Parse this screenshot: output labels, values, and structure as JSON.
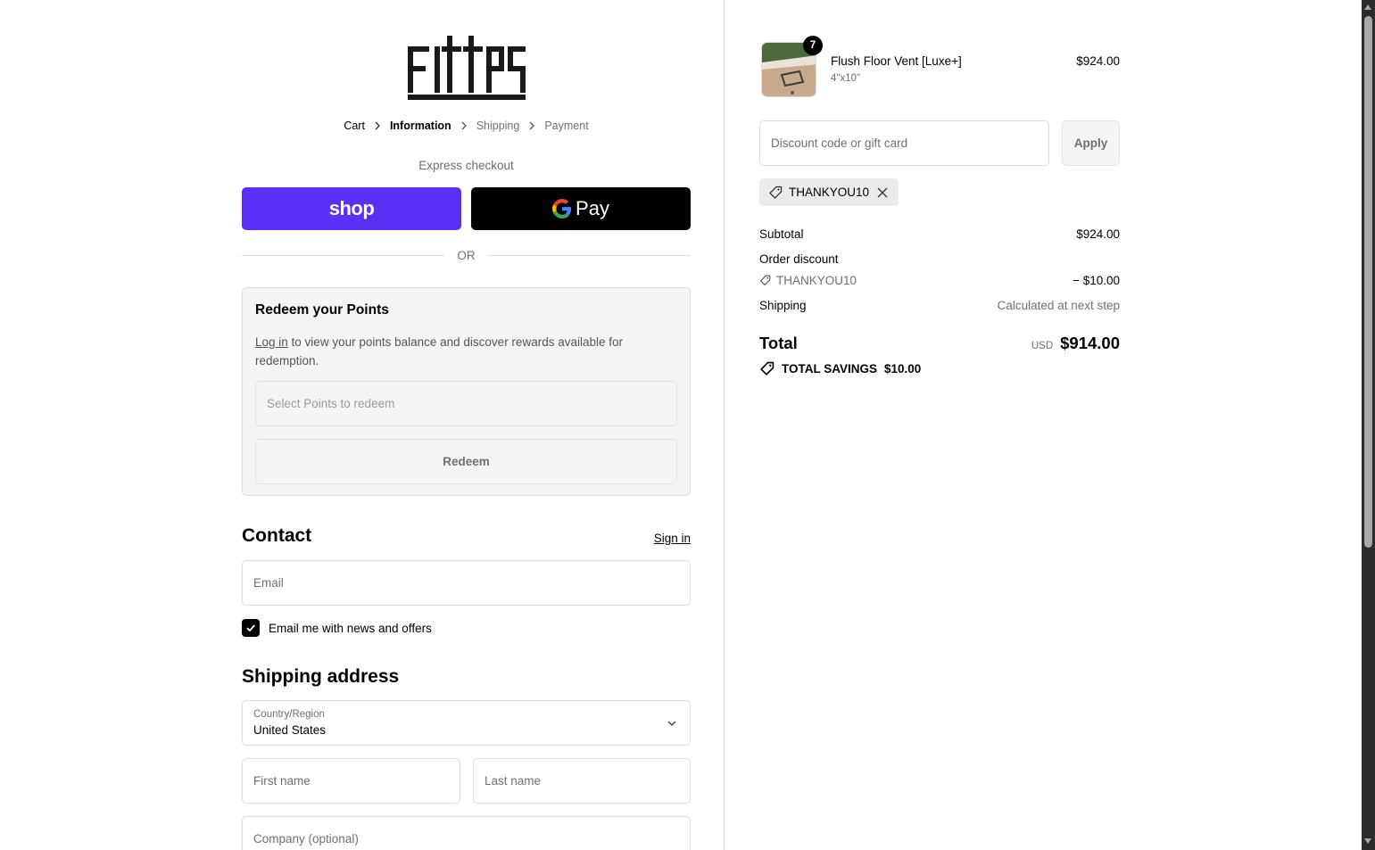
{
  "brand": {
    "logo_text": "Fittes"
  },
  "breadcrumb": [
    {
      "label": "Cart",
      "state": "done"
    },
    {
      "label": "Information",
      "state": "current"
    },
    {
      "label": "Shipping",
      "state": "upcoming"
    },
    {
      "label": "Payment",
      "state": "upcoming"
    }
  ],
  "express": {
    "label": "Express checkout",
    "shop_label": "shop",
    "gpay_label": "Pay",
    "or_text": "OR",
    "shop_color": "#5a31f4"
  },
  "points": {
    "title": "Redeem your Points",
    "login_link": "Log in",
    "text": " to view your points balance and discover rewards available for redemption.",
    "select_placeholder": "Select Points to redeem",
    "redeem_label": "Redeem"
  },
  "contact": {
    "title": "Contact",
    "signin_label": "Sign in",
    "email_placeholder": "Email",
    "newsletter_label": "Email me with news and offers",
    "newsletter_checked": true
  },
  "shipping": {
    "title": "Shipping address",
    "country_label": "Country/Region",
    "country_value": "United States",
    "first_name_placeholder": "First name",
    "last_name_placeholder": "Last name",
    "company_placeholder": "Company (optional)"
  },
  "order": {
    "item": {
      "name": "Flush Floor Vent [Luxe+]",
      "variant": "4\"x10\"",
      "quantity": "7",
      "price": "$924.00"
    },
    "discount_placeholder": "Discount code or gift card",
    "apply_label": "Apply",
    "applied_code": "THANKYOU10",
    "subtotal_label": "Subtotal",
    "subtotal_value": "$924.00",
    "order_discount_label": "Order discount",
    "discount_code": "THANKYOU10",
    "discount_value": "− $10.00",
    "shipping_label": "Shipping",
    "shipping_value": "Calculated at next step",
    "total_label": "Total",
    "total_currency": "USD",
    "total_value": "$914.00",
    "savings_label": "TOTAL SAVINGS",
    "savings_value": "$10.00"
  }
}
